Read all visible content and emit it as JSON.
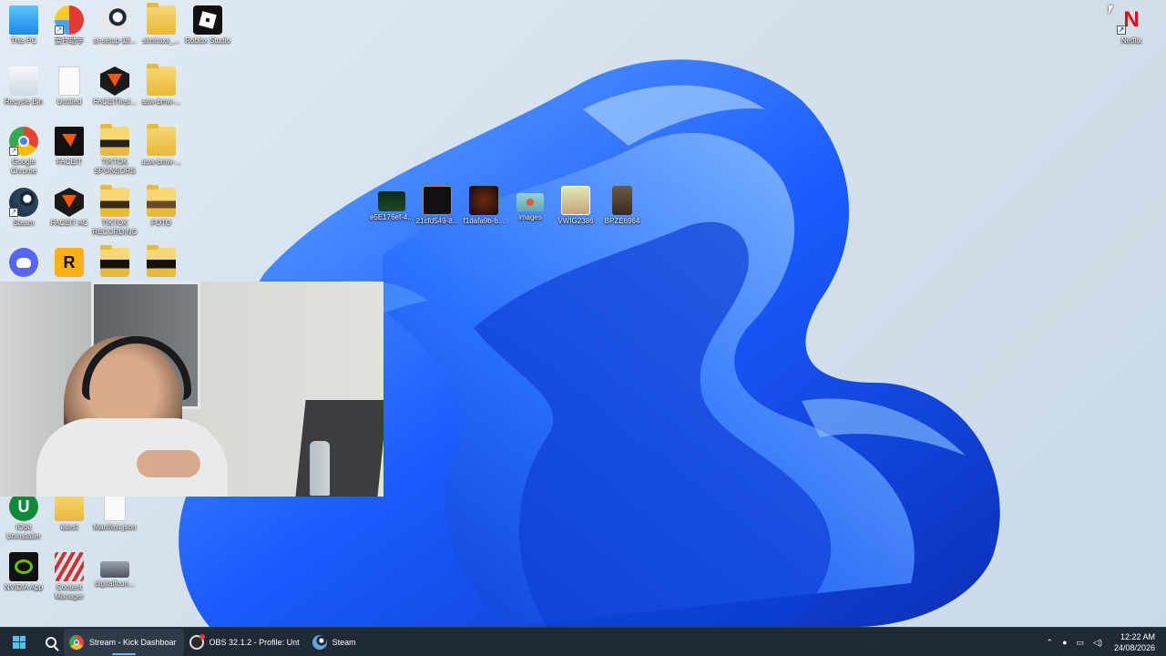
{
  "desktop": {
    "icons": [
      {
        "name": "this-pc-icon",
        "label": "This PC"
      },
      {
        "name": "app-chinese-icon",
        "label": "爱片助手"
      },
      {
        "name": "steam-setup-icon",
        "label": "st-setup-18..."
      },
      {
        "name": "folder-simtraxx-icon",
        "label": "simtraxx_..."
      },
      {
        "name": "roblox-studio-icon",
        "label": "Roblox Studio"
      },
      {
        "name": "recycle-bin-icon",
        "label": "Recycle Bin"
      },
      {
        "name": "untitled-file-icon",
        "label": "Untitled"
      },
      {
        "name": "faceit-installer-icon",
        "label": "FACEITInst..."
      },
      {
        "name": "folder-asw-bmw-1-icon",
        "label": "asw-bmw-..."
      },
      {
        "name": "google-chrome-icon",
        "label": "Google Chrome"
      },
      {
        "name": "faceit-icon",
        "label": "FACEIT"
      },
      {
        "name": "folder-tiktok-sponsors-icon",
        "label": "TIKTOK SPONSORS"
      },
      {
        "name": "folder-asw-bmw-2-icon",
        "label": "asw-bmw-..."
      },
      {
        "name": "steam-icon",
        "label": "Steam"
      },
      {
        "name": "faceit-ac-icon",
        "label": "FACEIT AC"
      },
      {
        "name": "folder-tiktok-recordings-icon",
        "label": "TIKTOK RECORDINGS"
      },
      {
        "name": "folder-foto-icon",
        "label": "FOTO"
      },
      {
        "name": "discord-icon",
        "label": ""
      },
      {
        "name": "rockstar-launcher-icon",
        "label": ""
      },
      {
        "name": "folder-dark-1-icon",
        "label": ""
      },
      {
        "name": "folder-dark-2-icon",
        "label": ""
      },
      {
        "name": "image-file-1-icon",
        "label": "e5E176ef-4..."
      },
      {
        "name": "image-file-2-icon",
        "label": "21cfd549-8..."
      },
      {
        "name": "image-file-3-icon",
        "label": "f1dafa9b-b..."
      },
      {
        "name": "images-file-icon",
        "label": "images"
      },
      {
        "name": "vwig-file-icon",
        "label": "VWIG2386"
      },
      {
        "name": "bpze-file-icon",
        "label": "BPZE6964"
      },
      {
        "name": "iobit-uninstaller-icon",
        "label": "IObit Uninstaller"
      },
      {
        "name": "folder-latest-icon",
        "label": "latest"
      },
      {
        "name": "manifest-file-icon",
        "label": "Manifest.json"
      },
      {
        "name": "nvidia-app-icon",
        "label": "NVIDIA App"
      },
      {
        "name": "content-manager-icon",
        "label": "Content Manager"
      },
      {
        "name": "digital-foundry-icon",
        "label": "digitalfoun..."
      },
      {
        "name": "netflix-icon",
        "label": "Netflix"
      }
    ]
  },
  "colors": {
    "taskbar": "#1f2a36",
    "accent": "#1a5cff",
    "netflix": "#e50914"
  },
  "taskbar": {
    "start": "start-icon",
    "search": "search-icon",
    "apps": [
      {
        "label": "Stream - Kick Dashboar",
        "icon": "chrome-icon",
        "active": true
      },
      {
        "label": "OBS 32.1.2 - Profile: Unt",
        "icon": "obs-icon",
        "active": false
      },
      {
        "label": "Steam",
        "icon": "steam-icon",
        "active": false
      }
    ],
    "tray": {
      "time": "12:22 AM",
      "date": "24/08/2026"
    }
  }
}
